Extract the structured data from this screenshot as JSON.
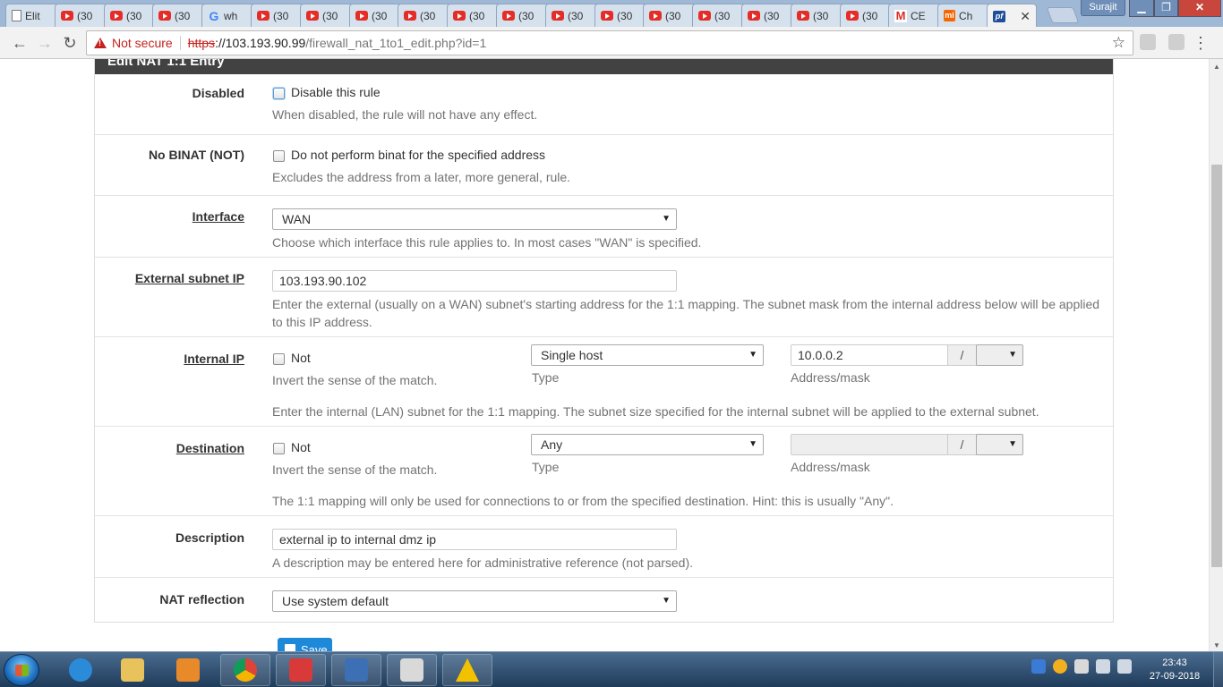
{
  "browser": {
    "tabs": [
      {
        "title": "Elit",
        "icon": "doc-icon"
      },
      {
        "title": "(30",
        "icon": "youtube-icon"
      },
      {
        "title": "(30",
        "icon": "youtube-icon"
      },
      {
        "title": "(30",
        "icon": "youtube-icon"
      },
      {
        "title": "wh",
        "icon": "google-icon"
      },
      {
        "title": "(30",
        "icon": "youtube-icon"
      },
      {
        "title": "(30",
        "icon": "youtube-icon"
      },
      {
        "title": "(30",
        "icon": "youtube-icon"
      },
      {
        "title": "(30",
        "icon": "youtube-icon"
      },
      {
        "title": "(30",
        "icon": "youtube-icon"
      },
      {
        "title": "(30",
        "icon": "youtube-icon"
      },
      {
        "title": "(30",
        "icon": "youtube-icon"
      },
      {
        "title": "(30",
        "icon": "youtube-icon"
      },
      {
        "title": "(30",
        "icon": "youtube-icon"
      },
      {
        "title": "(30",
        "icon": "youtube-icon"
      },
      {
        "title": "(30",
        "icon": "youtube-icon"
      },
      {
        "title": "(30",
        "icon": "youtube-icon"
      },
      {
        "title": "(30",
        "icon": "youtube-icon"
      },
      {
        "title": "CE",
        "icon": "gmail-icon"
      },
      {
        "title": "Ch",
        "icon": "mi-icon"
      },
      {
        "title": "",
        "icon": "pfsense-icon",
        "active": true
      }
    ],
    "user": "Surajit",
    "window_controls": {
      "minimize": "▁",
      "maximize": "❐",
      "close": "✕"
    },
    "nav_glyphs": {
      "back": "←",
      "forward": "→",
      "reload": "↻",
      "star": "☆",
      "menu": "⋮"
    },
    "security_label": "Not secure",
    "url_scheme": "https",
    "url_host": "://103.193.90.99",
    "url_path": "/firewall_nat_1to1_edit.php?id=1"
  },
  "form": {
    "heading": "Edit NAT 1:1 Entry",
    "disabled": {
      "label": "Disabled",
      "checkbox_text": "Disable this rule",
      "help": "When disabled, the rule will not have any effect."
    },
    "nobinat": {
      "label": "No BINAT (NOT)",
      "checkbox_text": "Do not perform binat for the specified address",
      "help": "Excludes the address from a later, more general, rule."
    },
    "interface": {
      "label": "Interface",
      "value": "WAN",
      "help": "Choose which interface this rule applies to. In most cases \"WAN\" is specified."
    },
    "external": {
      "label": "External subnet IP",
      "value": "103.193.90.102",
      "help_line1": "Enter the external (usually on a WAN) subnet's starting address for the 1:1 mapping. The subnet mask from the internal address below will be applied",
      "help_line2": "to this IP address."
    },
    "internal": {
      "label": "Internal IP",
      "not_text": "Not",
      "not_help": "Invert the sense of the match.",
      "type_value": "Single host",
      "type_label": "Type",
      "address_value": "10.0.0.2",
      "slash": "/",
      "mask_value": "",
      "address_label": "Address/mask",
      "help": "Enter the internal (LAN) subnet for the 1:1 mapping. The subnet size specified for the internal subnet will be applied to the external subnet."
    },
    "destination": {
      "label": "Destination",
      "not_text": "Not",
      "not_help": "Invert the sense of the match.",
      "type_value": "Any",
      "type_label": "Type",
      "address_value": "",
      "slash": "/",
      "mask_value": "",
      "address_label": "Address/mask",
      "help": "The 1:1 mapping will only be used for connections to or from the specified destination. Hint: this is usually \"Any\"."
    },
    "description": {
      "label": "Description",
      "value": "external ip to internal dmz ip",
      "help": "A description may be entered here for administrative reference (not parsed)."
    },
    "nat_reflection": {
      "label": "NAT reflection",
      "value": "Use system default"
    },
    "save_label": "Save"
  },
  "taskbar": {
    "time": "23:43",
    "date": "27-09-2018"
  },
  "colors": {
    "heading_bg": "#424242",
    "save_button": "#1e88d9",
    "not_secure": "#c5221f"
  }
}
